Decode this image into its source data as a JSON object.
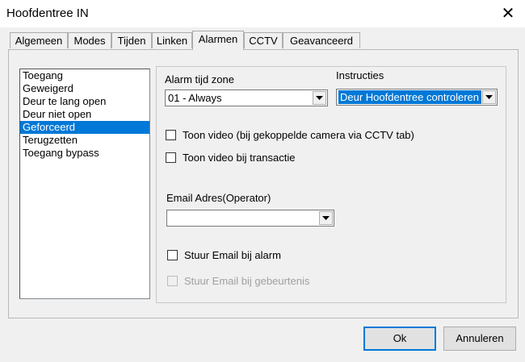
{
  "window": {
    "title": "Hoofdentree IN",
    "close_glyph": "✕"
  },
  "tabs": [
    {
      "label": "Algemeen"
    },
    {
      "label": "Modes"
    },
    {
      "label": "Tijden"
    },
    {
      "label": "Linken"
    },
    {
      "label": "Alarmen",
      "active": true
    },
    {
      "label": "CCTV"
    },
    {
      "label": "Geavanceerd"
    }
  ],
  "alarm_list": {
    "items": [
      "Toegang",
      "Geweigerd",
      "Deur te lang open",
      "Deur niet open",
      "Geforceerd",
      "Terugzetten",
      "Toegang bypass"
    ],
    "selected": "Geforceerd"
  },
  "form": {
    "alarm_zone_label": "Alarm tijd zone",
    "alarm_zone_value": "01 - Always",
    "instructies_label": "Instructies",
    "instructies_value": "Deur Hoofdentree controleren",
    "toon_video_cctv": "Toon video (bij gekoppelde camera via CCTV tab)",
    "toon_video_transactie": "Toon video bij transactie",
    "email_label": "Email Adres(Operator)",
    "email_value": "",
    "stuur_email_alarm": "Stuur Email bij alarm",
    "stuur_email_gebeurtenis": "Stuur Email bij gebeurtenis"
  },
  "buttons": {
    "ok": "Ok",
    "cancel": "Annuleren"
  },
  "colors": {
    "selection": "#0078d7",
    "default_button_border": "#0078d7"
  }
}
